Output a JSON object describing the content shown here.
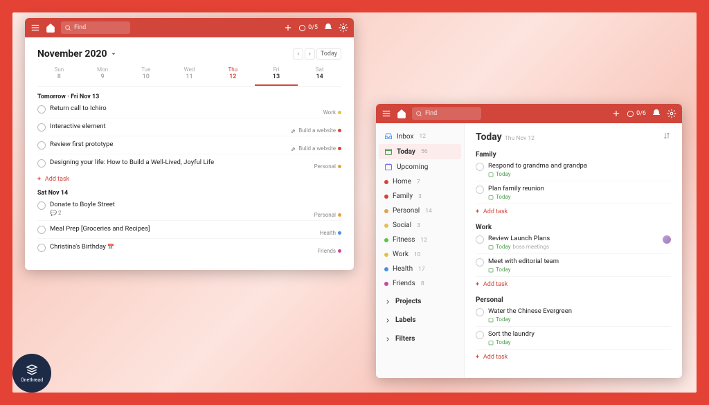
{
  "topbar": {
    "searchPlaceholder": "Find",
    "progress": "0/5"
  },
  "w1": {
    "month": "November 2020",
    "todayBtn": "Today",
    "days": [
      {
        "name": "Sun",
        "num": "8"
      },
      {
        "name": "Mon",
        "num": "9"
      },
      {
        "name": "Tue",
        "num": "10"
      },
      {
        "name": "Wed",
        "num": "11"
      },
      {
        "name": "Thu",
        "num": "12"
      },
      {
        "name": "Fri",
        "num": "13"
      },
      {
        "name": "Sat",
        "num": "14"
      }
    ],
    "sec1": "Tomorrow · Fri Nov 13",
    "tasks1": [
      {
        "title": "Return call to Ichiro",
        "tag": "Work",
        "dot": "#e2c24a",
        "icon": ""
      },
      {
        "title": "Interactive element",
        "tag": "Build a website",
        "dot": "#d1453b",
        "icon": "wrench"
      },
      {
        "title": "Review first prototype",
        "tag": "Build a website",
        "dot": "#d1453b",
        "icon": "wrench"
      },
      {
        "title": "Designing your life: How to Build a Well-Lived, Joyful Life",
        "tag": "Personal",
        "dot": "#e2a24a",
        "icon": ""
      }
    ],
    "addTask": "Add task",
    "sec2": "Sat Nov 14",
    "tasks2": [
      {
        "title": "Donate to Boyle Street",
        "meta": "2",
        "tag": "Personal",
        "dot": "#e2a24a"
      },
      {
        "title": "Meal Prep [Groceries and Recipes]",
        "tag": "Health",
        "dot": "#4a90e2"
      },
      {
        "title": "Christina's Birthday",
        "emoji": "📅",
        "tag": "Friends",
        "dot": "#c74aa0"
      }
    ]
  },
  "w2": {
    "topbar": {
      "searchPlaceholder": "Find",
      "progress": "0/6"
    },
    "sidebar": {
      "top": [
        {
          "label": "Inbox",
          "count": "12",
          "icon": "inbox",
          "color": "#5297ff"
        },
        {
          "label": "Today",
          "count": "56",
          "icon": "today",
          "color": "#4a9c4a",
          "active": true
        },
        {
          "label": "Upcoming",
          "count": "",
          "icon": "upcoming",
          "color": "#7b68ee"
        }
      ],
      "projects": [
        {
          "label": "Home",
          "count": "7",
          "dot": "#d1453b"
        },
        {
          "label": "Family",
          "count": "3",
          "dot": "#d1453b"
        },
        {
          "label": "Personal",
          "count": "14",
          "dot": "#e2a24a"
        },
        {
          "label": "Social",
          "count": "3",
          "dot": "#e2c24a"
        },
        {
          "label": "Fitness",
          "count": "12",
          "dot": "#5ac24a"
        },
        {
          "label": "Work",
          "count": "10",
          "dot": "#e2c24a"
        },
        {
          "label": "Health",
          "count": "17",
          "dot": "#4a90e2"
        },
        {
          "label": "Friends",
          "count": "8",
          "dot": "#c74aa0"
        }
      ],
      "sections": [
        "Projects",
        "Labels",
        "Filters"
      ]
    },
    "main": {
      "title": "Today",
      "date": "Thu Nov 12",
      "groups": [
        {
          "name": "Family",
          "tasks": [
            {
              "title": "Respond to grandma and grandpa",
              "date": "Today"
            },
            {
              "title": "Plan family reunion",
              "date": "Today"
            }
          ]
        },
        {
          "name": "Work",
          "tasks": [
            {
              "title": "Review Launch Plans",
              "date": "Today",
              "extra": "boss  meetings",
              "avatar": true
            },
            {
              "title": "Meet with editorial team",
              "date": "Today"
            }
          ]
        },
        {
          "name": "Personal",
          "tasks": [
            {
              "title": "Water the Chinese Evergreen",
              "date": "Today"
            },
            {
              "title": "Sort the laundry",
              "date": "Today"
            }
          ]
        }
      ],
      "addTask": "Add task"
    }
  },
  "logo": "Onethread"
}
